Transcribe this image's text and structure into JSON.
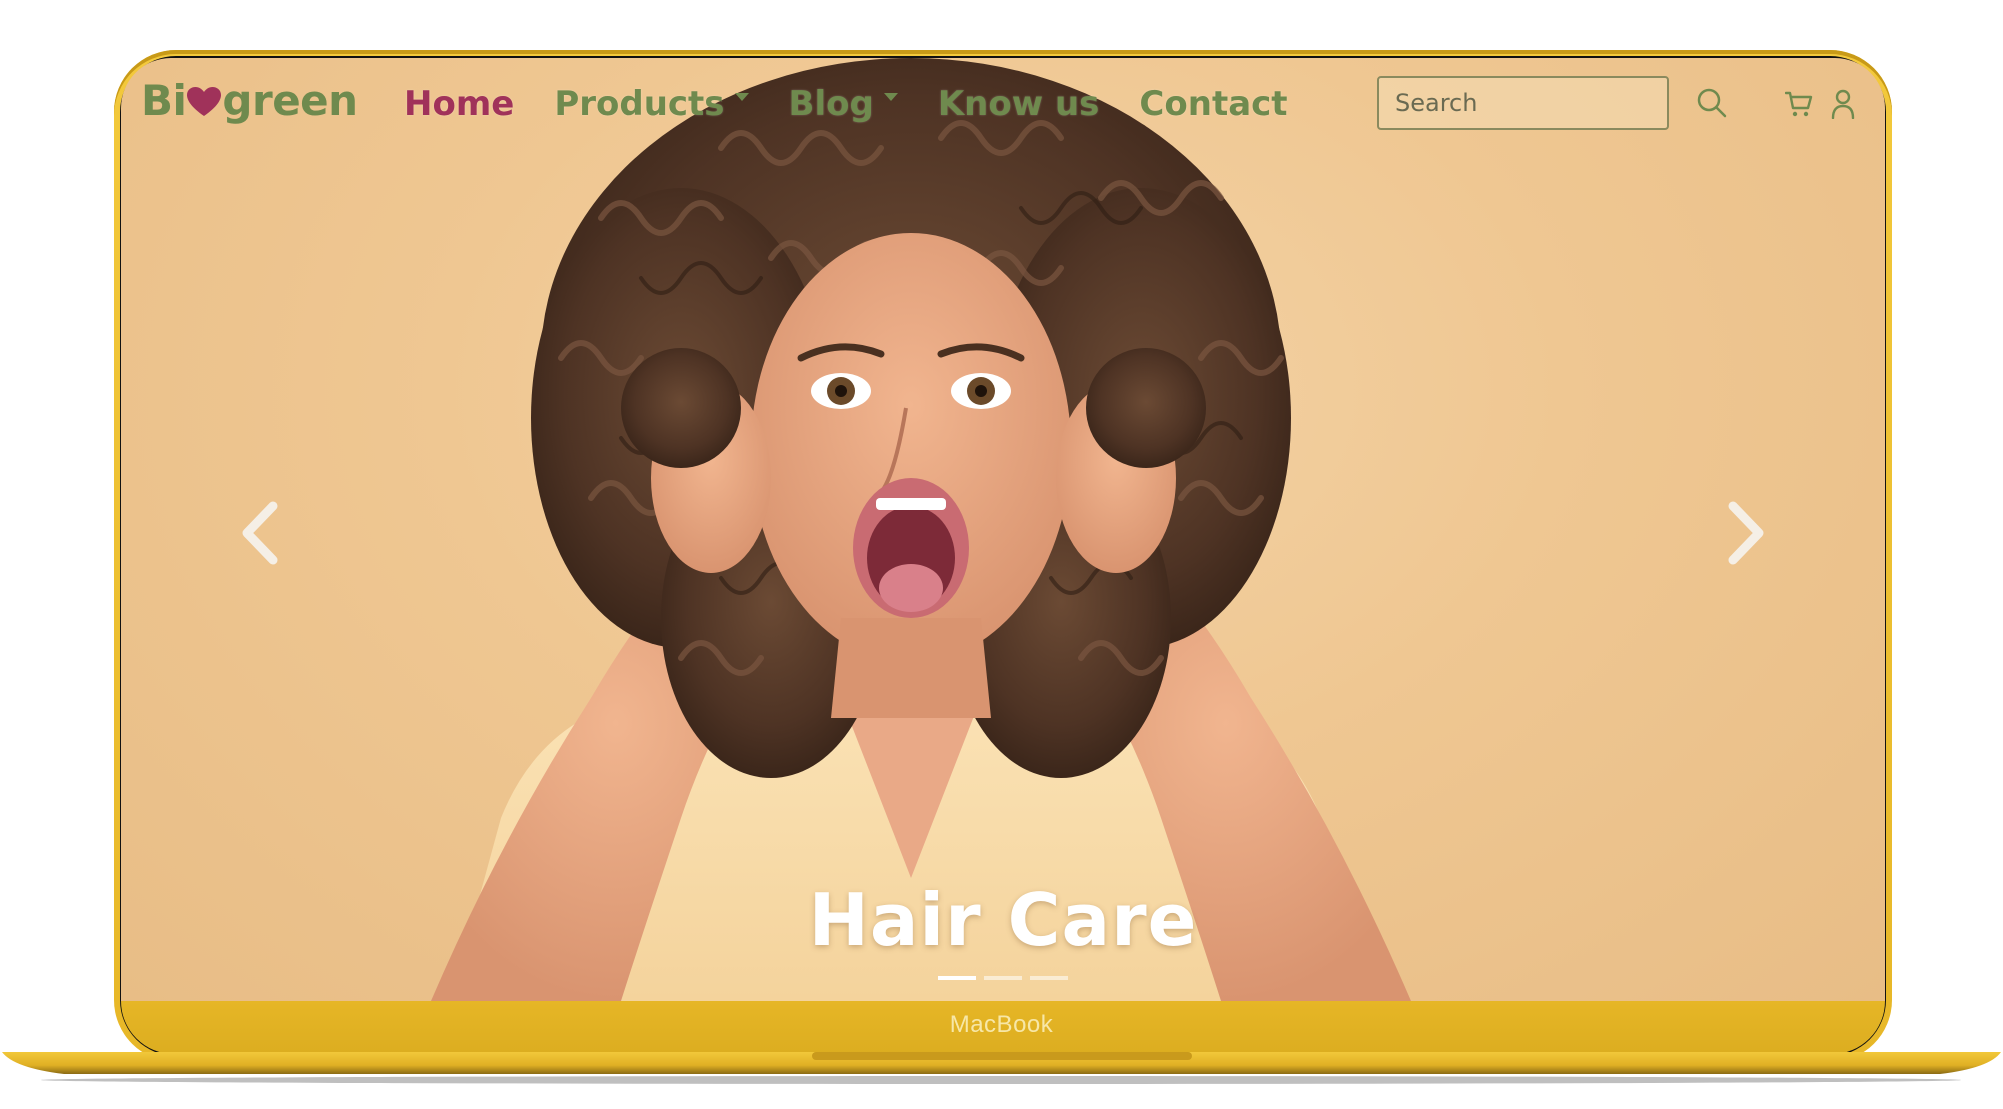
{
  "device": {
    "brand_label": "MacBook",
    "frame_color": "#f0c431"
  },
  "site": {
    "logo_text_left": "Bi",
    "logo_text_right": "green",
    "logo_heart_color": "#a0325a",
    "nav": [
      {
        "label": "Home",
        "active": true,
        "dropdown": false
      },
      {
        "label": "Products",
        "active": false,
        "dropdown": true
      },
      {
        "label": "Blog",
        "active": false,
        "dropdown": true
      },
      {
        "label": "Know us",
        "active": false,
        "dropdown": false
      },
      {
        "label": "Contact",
        "active": false,
        "dropdown": false
      }
    ],
    "search": {
      "placeholder": "Search"
    },
    "icons": {
      "search": "search-icon",
      "cart": "cart-icon",
      "user": "user-icon",
      "prev": "chevron-left-icon",
      "next": "chevron-right-icon"
    },
    "colors": {
      "nav_green": "#6f8a4e",
      "active_pink": "#a0325a",
      "hero_bg": "#efc792"
    }
  },
  "hero": {
    "caption": "Hair Care",
    "slides_count": 3,
    "active_slide": 1
  }
}
